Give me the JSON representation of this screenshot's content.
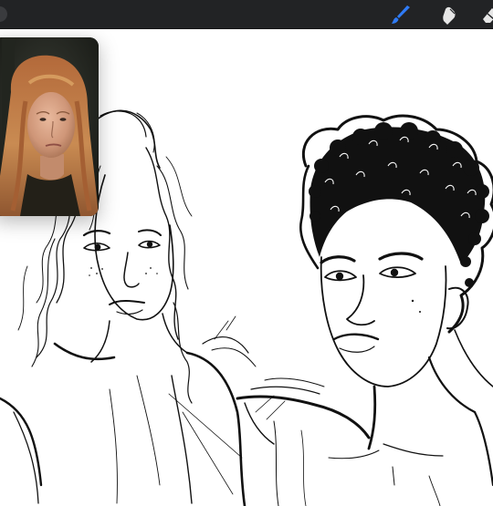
{
  "app": {
    "toolbar": {
      "tools": [
        {
          "name": "brush-icon",
          "active": true,
          "color": "#2f7bf6"
        },
        {
          "name": "smudge-icon",
          "active": false,
          "color": "#e8e8e8"
        },
        {
          "name": "eraser-icon",
          "active": false,
          "color": "#e8e8e8"
        }
      ]
    },
    "canvas": {
      "background": "#ffffff",
      "stroke_color": "#111111"
    },
    "reference_window": {
      "visible": true,
      "content": "photo"
    }
  }
}
